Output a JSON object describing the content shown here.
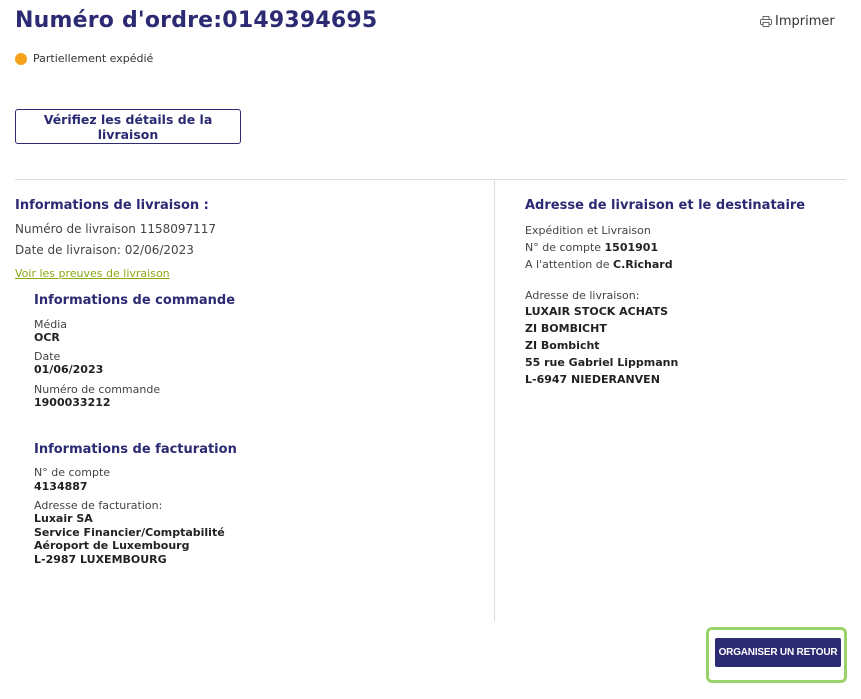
{
  "header": {
    "order_title": "Numéro d'ordre:0149394695",
    "print_label": "Imprimer",
    "status_label": "Partiellement expédié",
    "status_color": "#f5a31a"
  },
  "verify_button_label": "Vérifiez les détails de la livraison",
  "delivery_info": {
    "title": "Informations de livraison :",
    "delivery_number": "Numéro de livraison 1158097117",
    "delivery_date": "Date de livraison: 02/06/2023",
    "proof_link": "Voir les preuves de livraison"
  },
  "order_info": {
    "title": "Informations de commande",
    "media_label": "Média",
    "media_value": "OCR",
    "date_label": "Date",
    "date_value": "01/06/2023",
    "order_number_label": "Numéro de commande",
    "order_number_value": "1900033212"
  },
  "billing_info": {
    "title": "Informations de facturation",
    "account_label": "N° de compte",
    "account_value": "4134887",
    "address_label": "Adresse de facturation:",
    "address_lines": [
      "Luxair SA",
      "Service Financier/Comptabilité",
      "Aéroport de Luxembourg",
      "L-2987 LUXEMBOURG"
    ]
  },
  "shipping": {
    "title": "Adresse de livraison et le destinataire",
    "type_label": "Expédition et Livraison",
    "account_prefix": "N° de compte ",
    "account_value": "1501901",
    "attention_prefix": "A l'attention de ",
    "attention_value": "C.Richard",
    "address_label": "Adresse de livraison:",
    "address_lines": [
      "LUXAIR STOCK ACHATS",
      "ZI BOMBICHT",
      "ZI Bombicht",
      "55 rue Gabriel Lippmann",
      "L-6947 NIEDERANVEN"
    ]
  },
  "return_button_label": "ORGANISER UN RETOUR",
  "colors": {
    "brand": "#2b2a72",
    "link": "#8aa812",
    "highlight": "#9bd36b"
  },
  "icons": {
    "print": "printer-icon"
  }
}
